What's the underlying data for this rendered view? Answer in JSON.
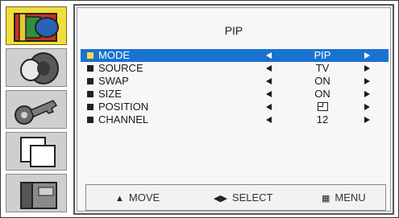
{
  "osd": {
    "title": "PIP",
    "menu": [
      {
        "label": "MODE",
        "value": "PIP",
        "selected": true
      },
      {
        "label": "SOURCE",
        "value": "TV",
        "selected": false
      },
      {
        "label": "SWAP",
        "value": "ON",
        "selected": false
      },
      {
        "label": "SIZE",
        "value": "ON",
        "selected": false
      },
      {
        "label": "POSITION",
        "value": "",
        "selected": false
      },
      {
        "label": "CHANNEL",
        "value": "12",
        "selected": false
      }
    ],
    "footer": {
      "move_label": "MOVE",
      "select_label": "SELECT",
      "menu_label": "MENU"
    }
  },
  "sidebar": {
    "icons": [
      "picture-icon",
      "sound-icon",
      "key-icon",
      "pip-windows-icon",
      "setup-icon"
    ],
    "active_index": 0
  },
  "colors": {
    "selected_row": "#1a72d0",
    "active_tile": "#f1dd3c",
    "bullet_selected": "#f5e04a"
  }
}
